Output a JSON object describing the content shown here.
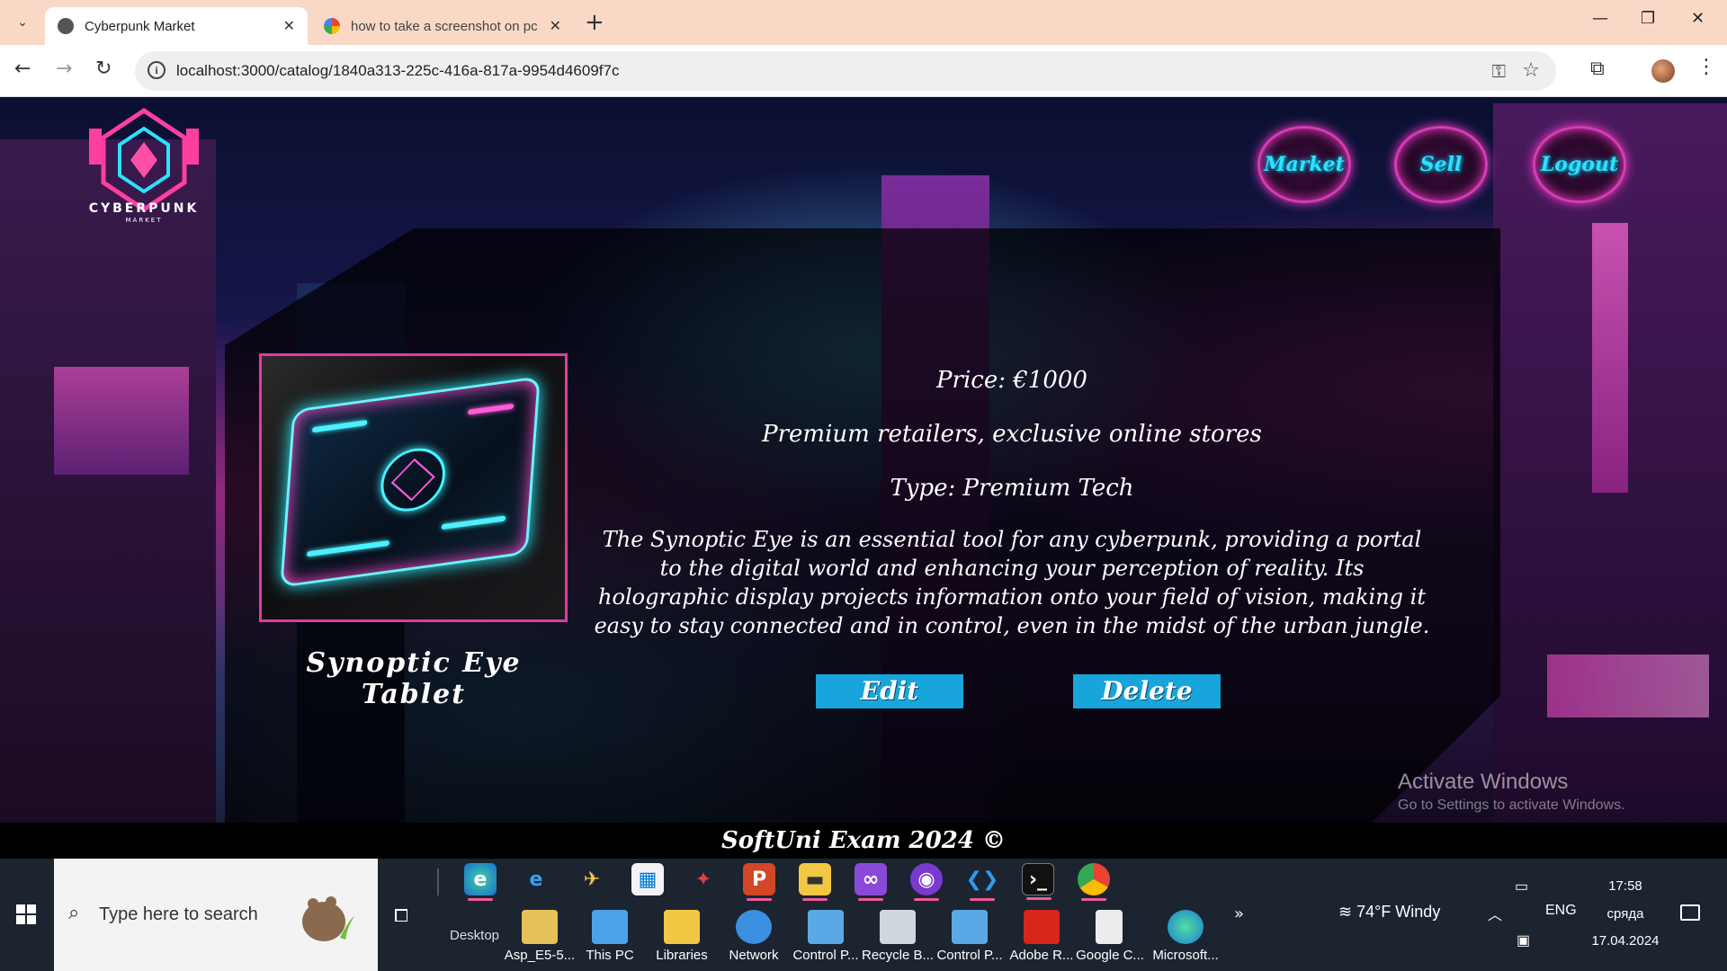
{
  "browser": {
    "tabs": [
      {
        "title": "Cyberpunk Market"
      },
      {
        "title": "how to take a screenshot on pc"
      }
    ],
    "url": "localhost:3000/catalog/1840a313-225c-416a-817a-9954d4609f7c"
  },
  "site": {
    "logo_text": "CYBERPUNK",
    "logo_sub": "MARKET",
    "nav": {
      "market": "Market",
      "sell": "Sell",
      "logout": "Logout"
    }
  },
  "product": {
    "name": "Synoptic Eye Tablet",
    "price": "Price: €1000",
    "seller": "Premium retailers, exclusive online stores",
    "type": "Type: Premium Tech",
    "description": "The Synoptic Eye is an essential tool for any cyberpunk, providing a portal to the digital world and enhancing your perception of reality. Its holographic display projects information onto your field of vision, making it easy to stay connected and in control, even in the midst of the urban jungle.",
    "edit_label": "Edit",
    "delete_label": "Delete"
  },
  "watermark": {
    "line1": "Activate Windows",
    "line2": "Go to Settings to activate Windows."
  },
  "footer": {
    "text": "SoftUni Exam 2024 ©"
  },
  "taskbar": {
    "search_placeholder": "Type here to search",
    "desktop_label": "Desktop",
    "desktop_items": [
      {
        "label": "Asp_E5-5...",
        "icon": "folder-user-icon",
        "color": "#e6c15a"
      },
      {
        "label": "This PC",
        "icon": "this-pc-icon",
        "color": "#4aa3e8"
      },
      {
        "label": "Libraries",
        "icon": "libraries-icon",
        "color": "#f2c744"
      },
      {
        "label": "Network",
        "icon": "network-icon",
        "color": "#3b8fe0"
      },
      {
        "label": "Control P...",
        "icon": "control-panel-icon",
        "color": "#5aa9e6"
      },
      {
        "label": "Recycle B...",
        "icon": "recycle-bin-icon",
        "color": "#cfd8df"
      },
      {
        "label": "Control P...",
        "icon": "control-panel-icon",
        "color": "#5aa9e6"
      },
      {
        "label": "Adobe R...",
        "icon": "adobe-reader-icon",
        "color": "#d8261d"
      },
      {
        "label": "Google C...",
        "icon": "file-icon",
        "color": "#ececec"
      },
      {
        "label": "Microsoft...",
        "icon": "edge-icon",
        "color": "#2bb3e0"
      }
    ],
    "weather": "74°F  Windy",
    "language": "ENG",
    "time": "17:58",
    "day": "сряда",
    "date": "17.04.2024"
  }
}
